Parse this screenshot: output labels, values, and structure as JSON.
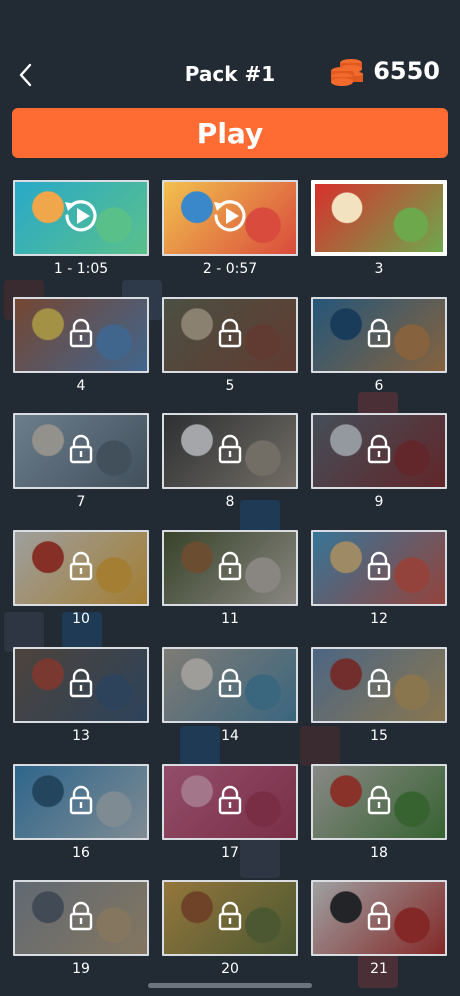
{
  "header": {
    "title": "Pack #1",
    "coins": "6550",
    "icons": {
      "back": "chevron-left-icon",
      "coins": "coin-stack-icon"
    }
  },
  "play_label": "Play",
  "colors": {
    "background": "#222b34",
    "accent": "#fe6b33",
    "border": "#d9dde2"
  },
  "levels": [
    {
      "label": "1 - 1:05",
      "state": "replay",
      "theme": "fruit slices"
    },
    {
      "label": "2 - 0:57",
      "state": "replay",
      "theme": "beach picnic"
    },
    {
      "label": "3",
      "state": "current",
      "theme": "sandwiches"
    },
    {
      "label": "4",
      "state": "locked",
      "theme": "dogs with sunglasses"
    },
    {
      "label": "5",
      "state": "locked",
      "theme": "cafe table"
    },
    {
      "label": "6",
      "state": "locked",
      "theme": "coral reef diver"
    },
    {
      "label": "7",
      "state": "locked",
      "theme": "beach skateboard"
    },
    {
      "label": "8",
      "state": "locked",
      "theme": "wedding couple"
    },
    {
      "label": "9",
      "state": "locked",
      "theme": "ice hockey"
    },
    {
      "label": "10",
      "state": "locked",
      "theme": "breakfast table"
    },
    {
      "label": "11",
      "state": "locked",
      "theme": "show jumping horse"
    },
    {
      "label": "12",
      "state": "locked",
      "theme": "girl on beach"
    },
    {
      "label": "13",
      "state": "locked",
      "theme": "vintage objects"
    },
    {
      "label": "14",
      "state": "locked",
      "theme": "map and travel"
    },
    {
      "label": "15",
      "state": "locked",
      "theme": "london big ben"
    },
    {
      "label": "16",
      "state": "locked",
      "theme": "dolphin show"
    },
    {
      "label": "17",
      "state": "locked",
      "theme": "makeup flatlay"
    },
    {
      "label": "18",
      "state": "locked",
      "theme": "tomato cooking"
    },
    {
      "label": "19",
      "state": "locked",
      "theme": "skydivers over city"
    },
    {
      "label": "20",
      "state": "locked",
      "theme": "vineyard picnic"
    },
    {
      "label": "21",
      "state": "locked",
      "theme": "music flatlay"
    }
  ]
}
